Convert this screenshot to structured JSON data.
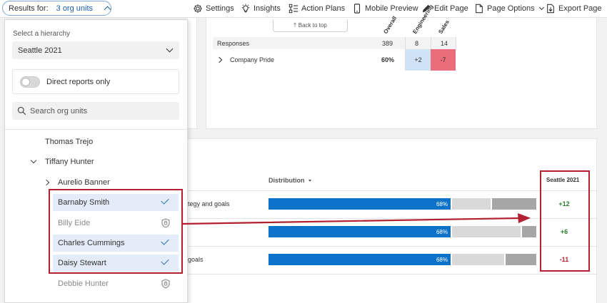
{
  "toolbar": {
    "results_label": "Results for:",
    "results_value": "3 org units",
    "settings": "Settings",
    "insights": "Insights",
    "action_plans": "Action Plans",
    "mobile_preview": "Mobile Preview",
    "edit_page": "Edit Page",
    "page_options": "Page Options",
    "export_page": "Export Page"
  },
  "heatmap": {
    "back_to_top": "Back to top",
    "col_overall": "Overall",
    "col_engineering": "Engineering",
    "col_sales": "Sales",
    "responses_label": "Responses",
    "responses_overall": "389",
    "responses_engineering": "8",
    "responses_sales": "14",
    "row_label": "Company Pride",
    "row_overall": "60%",
    "row_engineering": "+2",
    "row_sales": "-7",
    "color_positive": "#cfe2f6",
    "color_negative": "#eb6c7a"
  },
  "distribution": {
    "header": "Distribution",
    "compare_header": "Seattle 2021",
    "rows": [
      {
        "label": "tegy and goals",
        "pct": "68%",
        "fav": 0.68,
        "neutral": 0.15,
        "unfav": 0.17,
        "score": "+12"
      },
      {
        "label": "",
        "pct": "68%",
        "fav": 0.68,
        "neutral": 0.26,
        "unfav": 0.06,
        "score": "+6"
      },
      {
        "label": "goals",
        "pct": "68%",
        "fav": 0.68,
        "neutral": 0.2,
        "unfav": 0.12,
        "score": "-11"
      }
    ],
    "color_fav": "#0b72c9",
    "color_neutral": "#d9d9d9",
    "color_unfav": "#a6a6a6",
    "color_score_pos": "#2c7a2c",
    "color_score_neg": "#b3202f"
  },
  "dropdown": {
    "hierarchy_label": "Select a hierarchy",
    "hierarchy_value": "Seattle 2021",
    "direct_reports_label": "Direct reports only",
    "search_placeholder": "Search org units",
    "items": [
      {
        "name": "Thomas Trejo",
        "indent": 1,
        "chevron": "",
        "state": "normal"
      },
      {
        "name": "Tiffany Hunter",
        "indent": 1,
        "chevron": "down",
        "state": "normal"
      },
      {
        "name": "Aurelio Banner",
        "indent": 2,
        "chevron": "right",
        "state": "normal"
      },
      {
        "name": "Barnaby Smith",
        "indent": 2,
        "chevron": "",
        "state": "selected"
      },
      {
        "name": "Billy Eide",
        "indent": 2,
        "chevron": "",
        "state": "restricted"
      },
      {
        "name": "Charles Cummings",
        "indent": 2,
        "chevron": "",
        "state": "selected"
      },
      {
        "name": "Daisy Stewart",
        "indent": 2,
        "chevron": "",
        "state": "selected"
      },
      {
        "name": "Debbie Hunter",
        "indent": 2,
        "chevron": "",
        "state": "restricted"
      }
    ]
  },
  "icons": {
    "settings": "gear-icon",
    "insights": "lightbulb-icon",
    "action_plans": "action-plans-icon",
    "mobile_preview": "mobile-icon",
    "edit_page": "pencil-icon",
    "page_options": "page-icon",
    "export_page": "export-icon",
    "search": "search-icon",
    "check": "checkmark-icon",
    "restricted": "shield-icon"
  },
  "annotation_color": "#b3202f"
}
